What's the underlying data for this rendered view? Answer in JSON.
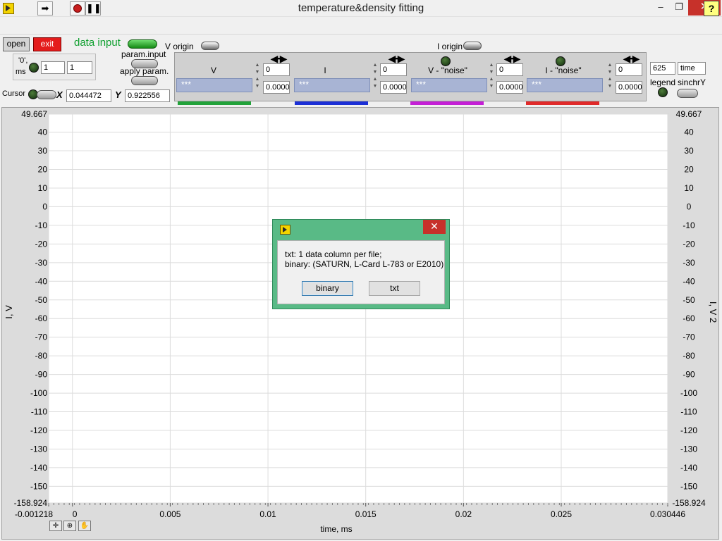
{
  "window": {
    "title": "temperature&density fitting",
    "minimize": "–",
    "restore": "❐",
    "close": "✕"
  },
  "toolbar": {
    "run": "➡",
    "pause": "❚❚",
    "help": "?"
  },
  "controls": {
    "open": "open",
    "exit": "exit",
    "data_input": "data input",
    "v_origin": "V origin",
    "i_origin": "I origin",
    "param_input": "param.input",
    "apply_param": "apply param.",
    "zero_label": "'0',",
    "ms_label": "ms",
    "zero_ms_value_1": "1",
    "zero_ms_value_2": "1",
    "cursor_label": "Cursor",
    "x_label": "X",
    "x_value": "0.044472",
    "y_label": "Y",
    "y_value": "0.922556",
    "time_value": "625",
    "time_label": "time",
    "legend_label": "legend",
    "sinchry_label": "sinchrY"
  },
  "channels": [
    {
      "name": "V",
      "value": "***",
      "top_field": "0",
      "bottom_field": "0.0000",
      "color": "#22a23a"
    },
    {
      "name": "I",
      "value": "***",
      "top_field": "0",
      "bottom_field": "0.0000",
      "color": "#1b2fd6"
    },
    {
      "name": "V - \"noise\"",
      "value": "***",
      "top_field": "0",
      "bottom_field": "0.0000",
      "color": "#c41fd6"
    },
    {
      "name": "I - \"noise\"",
      "value": "***",
      "top_field": "0",
      "bottom_field": "0.0000",
      "color": "#e02a2a"
    }
  ],
  "graph": {
    "y_left_label": "I, V",
    "y_right_label": "I, V 2",
    "x_label": "time, ms",
    "y_ticks": [
      "49.667",
      "40",
      "30",
      "20",
      "10",
      "0",
      "-10",
      "-20",
      "-30",
      "-40",
      "-50",
      "-60",
      "-70",
      "-80",
      "-90",
      "-100",
      "-110",
      "-120",
      "-130",
      "-140",
      "-150",
      "-158.924"
    ],
    "x_ticks": [
      "-0.001218",
      "0",
      "0.005",
      "0.01",
      "0.015",
      "0.02",
      "0.025",
      "0.030446"
    ],
    "ylim": [
      -158.924,
      49.667
    ],
    "xlim": [
      -0.001218,
      0.030446
    ],
    "grid": true
  },
  "dialog": {
    "line1": "txt: 1 data column per file;",
    "line2": "binary: (SATURN, L-Card L-783 or E2010)",
    "binary": "binary",
    "txt": "txt",
    "close": "✕"
  },
  "palette": {
    "cursor": "✛",
    "zoom": "⊕",
    "pan": "✋"
  }
}
